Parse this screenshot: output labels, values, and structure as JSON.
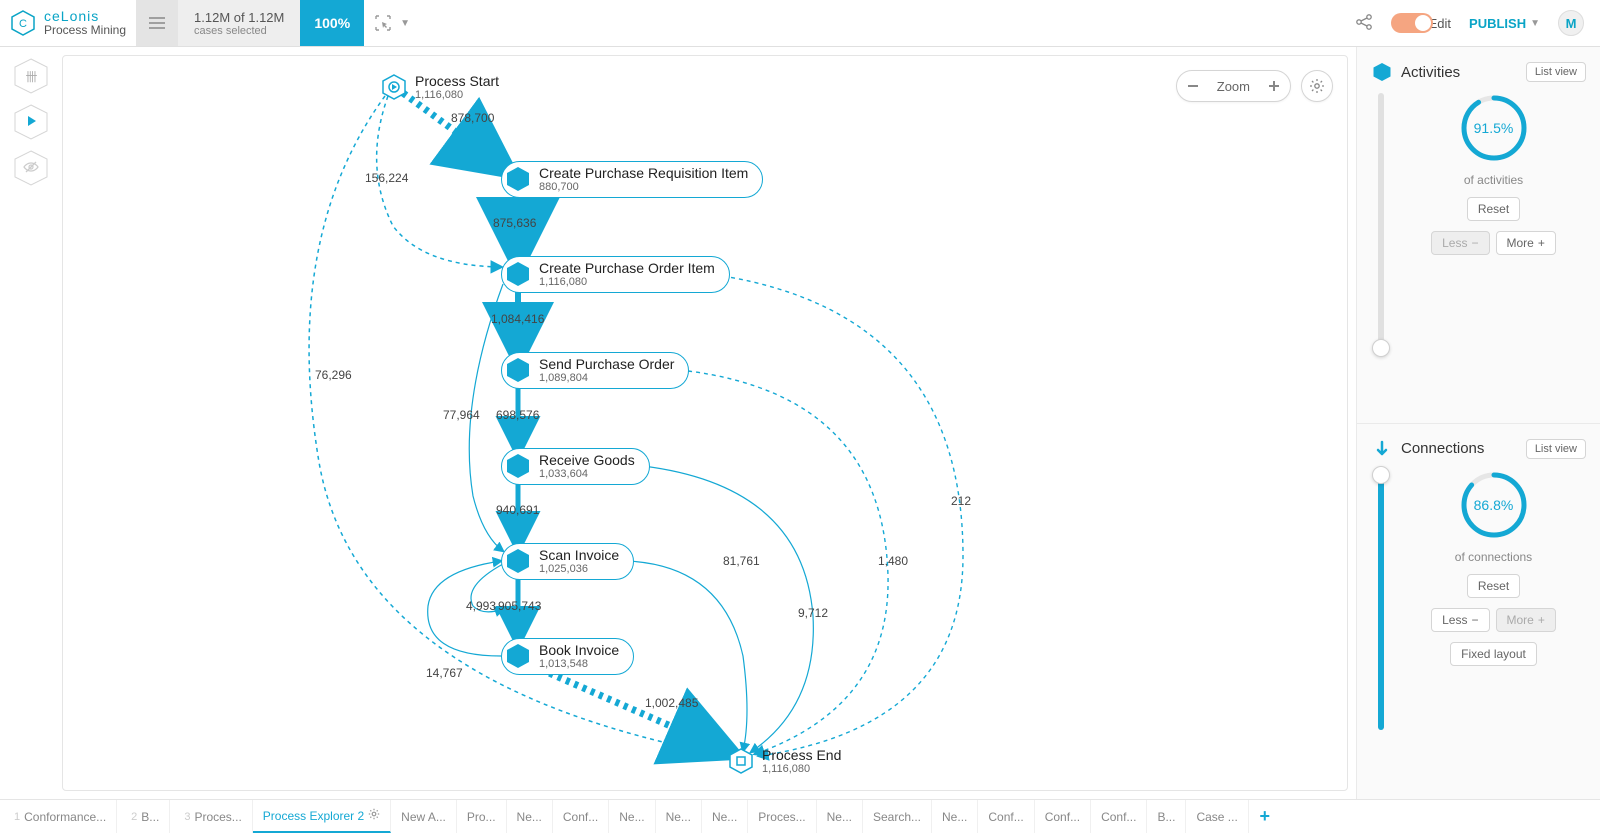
{
  "header": {
    "brand": "ceLonis",
    "subtitle": "Process Mining",
    "cases_main": "1.12M of 1.12M",
    "cases_sub": "cases selected",
    "percent": "100%",
    "edit_label": "Edit",
    "publish_label": "PUBLISH",
    "avatar": "M"
  },
  "canvas": {
    "zoom_label": "Zoom"
  },
  "nodes": {
    "start": {
      "title": "Process Start",
      "count": "1,116,080"
    },
    "cpri": {
      "title": "Create Purchase Requisition Item",
      "count": "880,700"
    },
    "cpoi": {
      "title": "Create Purchase Order Item",
      "count": "1,116,080"
    },
    "spo": {
      "title": "Send Purchase Order",
      "count": "1,089,804"
    },
    "rg": {
      "title": "Receive Goods",
      "count": "1,033,604"
    },
    "si": {
      "title": "Scan Invoice",
      "count": "1,025,036"
    },
    "bi": {
      "title": "Book Invoice",
      "count": "1,013,548"
    },
    "end": {
      "title": "Process End",
      "count": "1,116,080"
    }
  },
  "edges": {
    "e878700": "878,700",
    "e156224": "156,224",
    "e76296": "76,296",
    "e875636": "875,636",
    "e1084416": "1,084,416",
    "e77964": "77,964",
    "e698576": "698,576",
    "e940691": "940,691",
    "e4993": "4,993",
    "e905743": "905,743",
    "e14767": "14,767",
    "e1002485": "1,002,485",
    "e81761": "81,761",
    "e9712": "9,712",
    "e1480": "1,480",
    "e212": "212"
  },
  "panel": {
    "activities": {
      "title": "Activities",
      "list_view": "List view",
      "percent": "91.5%",
      "percent_val": 91.5,
      "of": "of activities",
      "reset": "Reset",
      "less": "Less",
      "more": "More"
    },
    "connections": {
      "title": "Connections",
      "list_view": "List view",
      "percent": "86.8%",
      "percent_val": 86.8,
      "of": "of connections",
      "reset": "Reset",
      "less": "Less",
      "more": "More",
      "fixed": "Fixed layout"
    }
  },
  "tabs": [
    "Conformance...",
    "B...",
    "Proces...",
    "Process Explorer 2",
    "New A...",
    "Pro...",
    "Ne...",
    "Conf...",
    "Ne...",
    "Ne...",
    "Ne...",
    "Proces...",
    "Ne...",
    "Search...",
    "Ne...",
    "Conf...",
    "Conf...",
    "Conf...",
    "B...",
    "Case ..."
  ],
  "active_tab": 3,
  "chart_data": {
    "type": "process_flow",
    "nodes": [
      {
        "id": "start",
        "label": "Process Start",
        "count": 1116080,
        "kind": "start"
      },
      {
        "id": "cpri",
        "label": "Create Purchase Requisition Item",
        "count": 880700
      },
      {
        "id": "cpoi",
        "label": "Create Purchase Order Item",
        "count": 1116080
      },
      {
        "id": "spo",
        "label": "Send Purchase Order",
        "count": 1089804
      },
      {
        "id": "rg",
        "label": "Receive Goods",
        "count": 1033604
      },
      {
        "id": "si",
        "label": "Scan Invoice",
        "count": 1025036
      },
      {
        "id": "bi",
        "label": "Book Invoice",
        "count": 1013548
      },
      {
        "id": "end",
        "label": "Process End",
        "count": 1116080,
        "kind": "end"
      }
    ],
    "edges": [
      {
        "from": "start",
        "to": "cpri",
        "count": 878700,
        "main": true
      },
      {
        "from": "start",
        "to": "cpoi",
        "count": 156224
      },
      {
        "from": "start",
        "to": "end",
        "count": 76296
      },
      {
        "from": "cpri",
        "to": "cpoi",
        "count": 875636,
        "main": true
      },
      {
        "from": "cpoi",
        "to": "spo",
        "count": 1084416,
        "main": true
      },
      {
        "from": "cpoi",
        "to": "si",
        "count": 77964
      },
      {
        "from": "cpoi",
        "to": "end",
        "count": 212
      },
      {
        "from": "spo",
        "to": "rg",
        "count": 698576,
        "main": true
      },
      {
        "from": "spo",
        "to": "end",
        "count": 1480
      },
      {
        "from": "rg",
        "to": "si",
        "count": 940691,
        "main": true
      },
      {
        "from": "rg",
        "to": "end",
        "count": 9712
      },
      {
        "from": "si",
        "to": "bi",
        "count": 905743,
        "main": true
      },
      {
        "from": "si",
        "to": "si",
        "count": 4993
      },
      {
        "from": "si",
        "to": "end",
        "count": 81761
      },
      {
        "from": "bi",
        "to": "end",
        "count": 1002485,
        "main": true
      },
      {
        "from": "bi",
        "to": "si",
        "count": 14767
      }
    ]
  }
}
